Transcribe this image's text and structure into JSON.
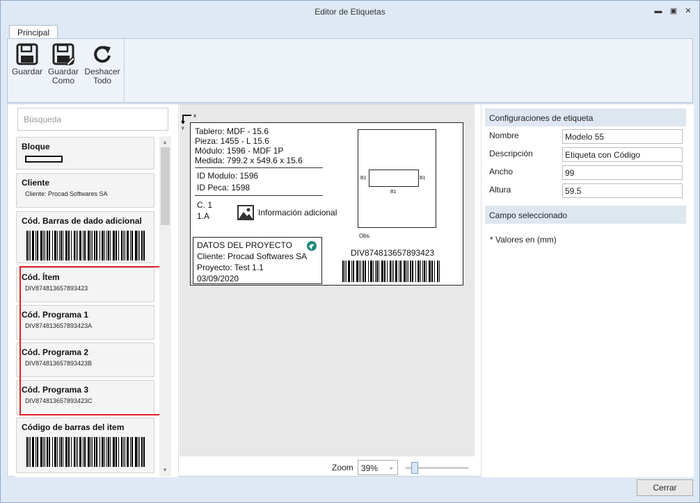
{
  "window": {
    "title": "Editor de Etiquetas"
  },
  "tabs": [
    {
      "label": "Principal"
    }
  ],
  "ribbon": {
    "buttons": [
      {
        "label": "Guardar",
        "icon": "floppy-icon"
      },
      {
        "label": "Guardar Como",
        "icon": "floppy-pencil-icon"
      },
      {
        "label": "Deshacer Todo",
        "icon": "redo-icon"
      }
    ]
  },
  "search": {
    "placeholder": "Búsqueda"
  },
  "cards": [
    {
      "title": "Bloque",
      "sub": ""
    },
    {
      "title": "Cliente",
      "sub": "Cliente: Procad Softwares SA"
    },
    {
      "title": "Cód. Barras de dado adicional",
      "sub": ""
    },
    {
      "title": "Cód. Ítem",
      "sub": "DIV874813657893423"
    },
    {
      "title": "Cód. Programa 1",
      "sub": "DIV874813657893423A"
    },
    {
      "title": "Cód. Programa 2",
      "sub": "DIV874813657893423B"
    },
    {
      "title": "Cód. Programa 3",
      "sub": "DIV874813657893423C"
    },
    {
      "title": "Código de barras del item",
      "sub": ""
    }
  ],
  "label": {
    "axis_x": "x",
    "axis_y": "y",
    "lines_top": [
      "Tablero: MDF - 15.6",
      "Pieza: 1455 - L 15.6",
      "Módulo: 1596 - MDF 1P",
      "Medida: 799.2 x 549.6 x 15.6"
    ],
    "lines_mid": [
      "ID Modulo: 1596",
      "ID Peca: 1598"
    ],
    "c1": "C. 1",
    "c1a": "1.A",
    "info": "Información adicional",
    "box_title": "DATOS DEL PROYECTO",
    "box_lines": [
      "Cliente: Procad Softwares SA",
      "Proyecto: Test 1.1",
      "03/09/2020"
    ],
    "b1": "B1",
    "obs": "Obs.",
    "code": "DIV874813657893423"
  },
  "zoom": {
    "label": "Zoom",
    "value": "39%",
    "level": 0.1
  },
  "right": {
    "section1": "Configuraciones de etiqueta",
    "fields": [
      {
        "label": "Nombre",
        "value": "Modelo 55"
      },
      {
        "label": "Descripción",
        "value": "Etiqueta con Código"
      },
      {
        "label": "Ancho",
        "value": "99"
      },
      {
        "label": "Altura",
        "value": "59.5"
      }
    ],
    "section2": "Campo seleccionado",
    "note": "* Valores en (mm)"
  },
  "footer": {
    "close_label": "Cerrar"
  }
}
